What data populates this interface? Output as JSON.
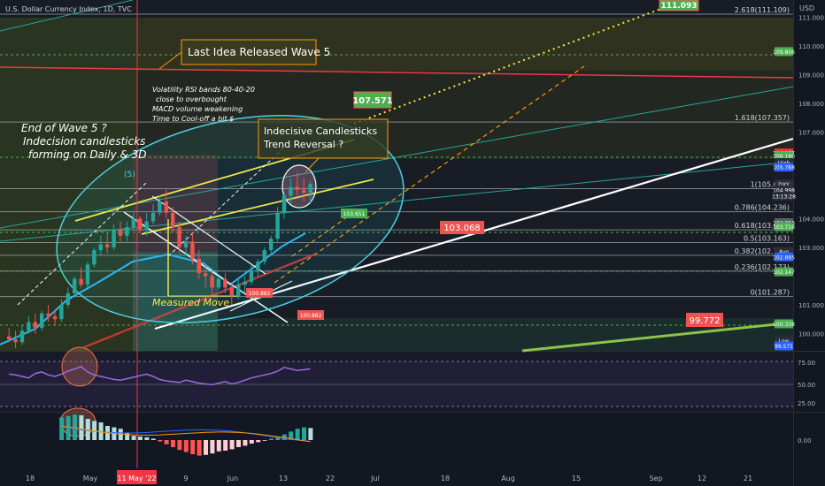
{
  "header": {
    "symbol_line": "U.S. Dollar Currency Index, 1D, TVC",
    "currency": "USD"
  },
  "chart_data": {
    "type": "candlestick",
    "symbol": "DXY",
    "price_axis": {
      "ylim": [
        99.4,
        111.6
      ],
      "ticks": [
        111.0,
        110.0,
        109.0,
        108.0,
        107.0,
        104.0,
        103.0,
        101.0,
        100.0
      ]
    },
    "time_axis": {
      "labels": [
        "18",
        "May",
        "9",
        "Jun",
        "13",
        "22",
        "Jul",
        "18",
        "Aug",
        "15",
        "Sep",
        "12",
        "21"
      ],
      "highlight_label": "11 May '22"
    },
    "candles": [
      [
        99.9,
        100.2,
        99.7,
        99.8
      ],
      [
        99.8,
        100.1,
        99.5,
        99.7
      ],
      [
        99.7,
        100.3,
        99.6,
        100.1
      ],
      [
        100.1,
        100.6,
        100.0,
        100.4
      ],
      [
        100.4,
        100.7,
        100.0,
        100.2
      ],
      [
        100.2,
        100.8,
        100.1,
        100.7
      ],
      [
        100.7,
        101.0,
        100.4,
        100.6
      ],
      [
        100.6,
        100.8,
        100.3,
        100.5
      ],
      [
        100.5,
        101.2,
        100.4,
        101.0
      ],
      [
        101.0,
        101.6,
        100.9,
        101.4
      ],
      [
        101.4,
        102.0,
        101.3,
        101.9
      ],
      [
        101.9,
        102.3,
        101.6,
        101.7
      ],
      [
        101.7,
        102.5,
        101.6,
        102.4
      ],
      [
        102.4,
        103.0,
        102.3,
        102.9
      ],
      [
        102.9,
        103.4,
        102.7,
        103.1
      ],
      [
        103.1,
        103.5,
        102.8,
        103.0
      ],
      [
        103.0,
        103.8,
        102.9,
        103.6
      ],
      [
        103.6,
        103.9,
        103.2,
        103.4
      ],
      [
        103.4,
        103.9,
        103.2,
        103.7
      ],
      [
        103.7,
        104.2,
        103.6,
        104.0
      ],
      [
        104.0,
        104.1,
        103.5,
        103.6
      ],
      [
        103.6,
        104.2,
        103.4,
        103.9
      ],
      [
        103.9,
        104.5,
        103.8,
        104.2
      ],
      [
        104.2,
        104.8,
        104.1,
        104.6
      ],
      [
        104.6,
        105.0,
        104.0,
        104.2
      ],
      [
        104.2,
        104.4,
        103.5,
        103.7
      ],
      [
        103.7,
        103.9,
        102.8,
        103.0
      ],
      [
        103.0,
        103.4,
        102.7,
        103.2
      ],
      [
        103.2,
        103.5,
        102.4,
        102.6
      ],
      [
        102.6,
        102.9,
        101.9,
        102.1
      ],
      [
        102.1,
        102.4,
        101.6,
        102.0
      ],
      [
        102.0,
        102.2,
        101.3,
        101.6
      ],
      [
        101.6,
        102.0,
        101.5,
        101.9
      ],
      [
        101.9,
        102.1,
        101.4,
        101.6
      ],
      [
        101.6,
        101.8,
        101.0,
        101.3
      ],
      [
        101.3,
        101.9,
        101.2,
        101.7
      ],
      [
        101.7,
        102.0,
        101.4,
        101.8
      ],
      [
        101.8,
        102.4,
        101.7,
        102.2
      ],
      [
        102.2,
        102.6,
        102.0,
        102.5
      ],
      [
        102.5,
        103.0,
        102.4,
        102.9
      ],
      [
        102.9,
        103.4,
        102.8,
        103.3
      ],
      [
        103.3,
        104.4,
        103.2,
        104.2
      ],
      [
        104.2,
        104.9,
        104.0,
        104.8
      ],
      [
        104.8,
        105.4,
        104.5,
        105.1
      ],
      [
        105.1,
        105.6,
        104.8,
        105.0
      ],
      [
        105.0,
        105.4,
        104.6,
        104.9
      ],
      [
        104.9,
        105.3,
        104.5,
        105.2
      ]
    ],
    "horizontal_levels": [
      {
        "label": "2.618(111.109)",
        "value": 111.109
      },
      {
        "label": "1.618(107.357)",
        "value": 107.357
      },
      {
        "label": "1(105.039)",
        "value": 105.039
      },
      {
        "label": "0.786(104.236)",
        "value": 104.236
      },
      {
        "label": "0.618(103.606)",
        "value": 103.606
      },
      {
        "label": "0.5(103.163)",
        "value": 103.163
      },
      {
        "label": "0.382(102.721)",
        "value": 102.721
      },
      {
        "label": "0.236(102.173)",
        "value": 102.173
      },
      {
        "label": "0(101.287)",
        "value": 101.287
      }
    ],
    "price_tags": [
      {
        "text": "109.806",
        "value": 109.806,
        "color": "#4caf50"
      },
      {
        "text": "106.277",
        "value": 106.277,
        "color": "#f23645"
      },
      {
        "text": "106.180",
        "value": 106.18,
        "color": "#4caf50"
      },
      {
        "text": "High",
        "value": 105.95,
        "color": "#2a2e39"
      },
      {
        "text": "105.788",
        "value": 105.788,
        "color": "#2962ff"
      },
      {
        "text": "DXY",
        "value": 105.2,
        "color": "#2a2e39"
      },
      {
        "text": "104.998",
        "value": 104.998,
        "color": "#2a2e39"
      },
      {
        "text": "13:13:28",
        "value": 104.78,
        "color": "#2a2e39"
      },
      {
        "text": "103.856",
        "value": 103.856,
        "color": "#5d606b"
      },
      {
        "text": "103.718",
        "value": 103.718,
        "color": "#4caf50"
      },
      {
        "text": "Avg",
        "value": 102.85,
        "color": "#2a2e39"
      },
      {
        "text": "102.665",
        "value": 102.665,
        "color": "#2962ff"
      },
      {
        "text": "102.147",
        "value": 102.147,
        "color": "#4caf50"
      },
      {
        "text": "100.338",
        "value": 100.338,
        "color": "#4caf50"
      },
      {
        "text": "Low",
        "value": 99.75,
        "color": "#2a2e39"
      },
      {
        "text": "99.571",
        "value": 99.571,
        "color": "#2962ff"
      }
    ],
    "annotations": {
      "last_idea": "Last Idea Released Wave 5",
      "volatility_note": [
        "Volatility RSI bands 80-40-20",
        "close to overbought",
        "MACD volume weakening",
        "Time to Cool-off a bit $"
      ],
      "wave_end_note": [
        "End of Wave 5 ?",
        "Indecision candlesticks",
        "forming on Daily & 3D"
      ],
      "indecisive_note": [
        "Indecisive Candlesticks",
        "Trend Reversal ?"
      ],
      "wave_label": "(5)",
      "measured_move": "Measured Move",
      "target_top": "111.093",
      "target_107": "107.571",
      "tag_103_651": "103.651",
      "tag_103_068": "103.068",
      "tag_100_882a": "100.882",
      "tag_100_882b": "100.882",
      "tag_99_772": "99.772"
    },
    "rsi": {
      "axis_labels": [
        "75.00",
        "50.00",
        "25.00"
      ],
      "values": [
        63,
        62,
        60,
        58,
        64,
        66,
        62,
        60,
        63,
        67,
        70,
        73,
        66,
        62,
        60,
        58,
        56,
        55,
        57,
        59,
        61,
        63,
        60,
        56,
        54,
        53,
        52,
        55,
        53,
        51,
        50,
        49,
        51,
        53,
        50,
        52,
        55,
        58,
        60,
        62,
        64,
        67,
        72,
        70,
        68,
        69,
        70
      ]
    },
    "macd": {
      "axis_label": "0.00",
      "histogram": [
        0.32,
        0.34,
        0.36,
        0.35,
        0.3,
        0.27,
        0.25,
        0.2,
        0.18,
        0.16,
        0.1,
        0.06,
        0.05,
        0.04,
        0.02,
        -0.02,
        -0.06,
        -0.1,
        -0.14,
        -0.17,
        -0.2,
        -0.22,
        -0.21,
        -0.19,
        -0.16,
        -0.15,
        -0.13,
        -0.1,
        -0.08,
        -0.05,
        -0.03,
        -0.01,
        0.02,
        0.05,
        0.08,
        0.12,
        0.16,
        0.18,
        0.17
      ]
    }
  }
}
